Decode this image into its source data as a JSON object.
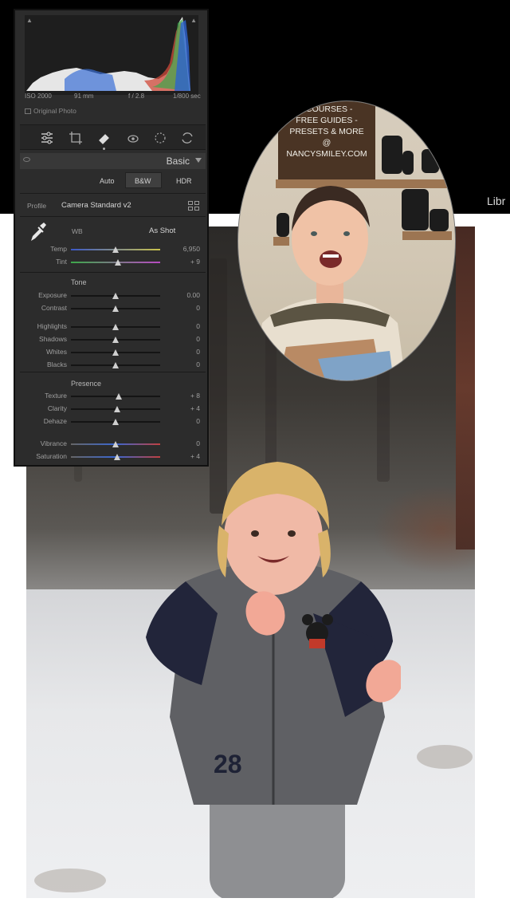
{
  "app": {
    "library_label": "Libr"
  },
  "histogram": {
    "iso": "ISO 2000",
    "focal_length": "91 mm",
    "aperture": "f / 2.8",
    "shutter": "1/800 sec",
    "original_photo_label": "Original Photo"
  },
  "tools": [
    "edit-sliders-icon",
    "crop-icon",
    "healing-icon",
    "redeye-icon",
    "masking-icon",
    "presets-icon"
  ],
  "basic": {
    "title": "Basic",
    "treatment_buttons": {
      "auto": "Auto",
      "bw": "B&W",
      "hdr": "HDR"
    },
    "profile_label": "Profile",
    "profile_value": "Camera Standard v2",
    "wb_label": "WB",
    "wb_value": "As Shot",
    "tone_title": "Tone",
    "presence_title": "Presence",
    "wb_sliders": [
      {
        "label": "Temp",
        "value": "6,950",
        "position": 0.5
      },
      {
        "label": "Tint",
        "value": "+ 9",
        "position": 0.53
      }
    ],
    "tone_sliders": [
      {
        "label": "Exposure",
        "value": "0.00",
        "position": 0.5
      },
      {
        "label": "Contrast",
        "value": "0",
        "position": 0.5
      },
      {
        "label": "Highlights",
        "value": "0",
        "position": 0.5
      },
      {
        "label": "Shadows",
        "value": "0",
        "position": 0.5
      },
      {
        "label": "Whites",
        "value": "0",
        "position": 0.5
      },
      {
        "label": "Blacks",
        "value": "0",
        "position": 0.5
      }
    ],
    "presence_sliders": [
      {
        "label": "Texture",
        "value": "+ 8",
        "position": 0.54
      },
      {
        "label": "Clarity",
        "value": "+ 4",
        "position": 0.52
      },
      {
        "label": "Dehaze",
        "value": "0",
        "position": 0.5
      },
      {
        "label": "Vibrance",
        "value": "0",
        "position": 0.5
      },
      {
        "label": "Saturation",
        "value": "+ 4",
        "position": 0.52
      }
    ]
  },
  "portrait_sign": {
    "lines": [
      "- COURSES -",
      "FREE GUIDES -",
      "PRESETS & MORE",
      "@",
      "NANCYSMILEY.COM"
    ]
  },
  "photo": {
    "jacket_number": "28"
  },
  "colors": {
    "panel_bg": "#2c2c2c",
    "accent_slider": "#cfcfcf"
  }
}
